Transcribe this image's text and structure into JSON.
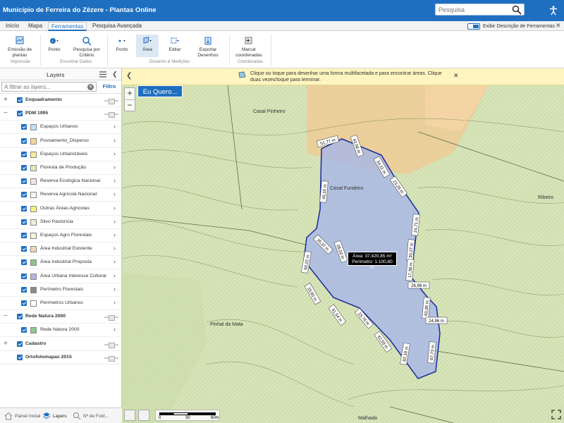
{
  "app": {
    "title": "Município de Ferreira do Zêzere - Plantas Online",
    "search_placeholder": "Pesquisa"
  },
  "tabs": [
    {
      "label": "Início"
    },
    {
      "label": "Mapa"
    },
    {
      "label": "Ferramentas",
      "active": true
    },
    {
      "label": "Pesquisa Avançada"
    }
  ],
  "toggle_description_label": "Exibir Descrição de Ferramentas",
  "ribbon": {
    "buttons": {
      "emissao": "Emissão de plantas",
      "ponto_info": "Ponto",
      "pesquisa_criterio": "Pesquisa por Critério",
      "ponto_draw": "Ponto",
      "area": "Área",
      "editar": "Editar",
      "exportar": "Exportar Desenhos",
      "marcar": "Marcar coordenadas"
    },
    "groups": {
      "impressao": "Impressão",
      "encontrar": "Encontrar Dados",
      "desenho": "Desenho & Medições",
      "coordenadas": "Coordenadas"
    }
  },
  "sidebar": {
    "title": "Layers",
    "filter_placeholder": "A filtrar as layers...",
    "filter_button": "Filtro",
    "layers": [
      {
        "name": "Enquadramento",
        "level": 0,
        "expander": "+",
        "bold": true,
        "swatch": null
      },
      {
        "name": "PDM 1995",
        "level": 0,
        "expander": "−",
        "bold": true,
        "swatch": null
      },
      {
        "name": "Espaços Urbanos",
        "level": 1,
        "swatch": "#bfe3f7"
      },
      {
        "name": "Povoamento_Disperso",
        "level": 1,
        "swatch": "#f2d79a"
      },
      {
        "name": "Espaços Urbanizáveis",
        "level": 1,
        "swatch": "#f7ec9a"
      },
      {
        "name": "Floresta de Produção",
        "level": 1,
        "swatch": "#d9ecb2"
      },
      {
        "name": "Reserva Ecológica Nacional",
        "level": 1,
        "swatch": "#f2e4ea"
      },
      {
        "name": "Reserva Agrícola Nacional",
        "level": 1,
        "swatch": "#f4f4f4"
      },
      {
        "name": "Outras Áreas Agrícolas",
        "level": 1,
        "swatch": "#f7f27a"
      },
      {
        "name": "Silvo Pastorícia",
        "level": 1,
        "swatch": "#eaf0dc"
      },
      {
        "name": "Espaços Agro Florestais",
        "level": 1,
        "swatch": "#f4f2d8"
      },
      {
        "name": "Área Industrial Existente",
        "level": 1,
        "swatch": "#eed7b7"
      },
      {
        "name": "Área Industrial Proposta",
        "level": 1,
        "swatch": "#8ec48a"
      },
      {
        "name": "Área Urbana Interesse Cultural",
        "level": 1,
        "swatch": "#b7b3e3"
      },
      {
        "name": "Perímetro Florestais",
        "level": 1,
        "swatch": "#8a8a8a"
      },
      {
        "name": "Perímetros Urbanos",
        "level": 1,
        "swatch": "#ffffff"
      },
      {
        "name": "Rede Natura 2000",
        "level": 0,
        "expander": "−",
        "bold": true,
        "swatch": null
      },
      {
        "name": "Rede Natura 2000",
        "level": 1,
        "swatch": "#8cc98a"
      },
      {
        "name": "Cadastro",
        "level": 0,
        "expander": "+",
        "bold": true,
        "swatch": null
      },
      {
        "name": "Ortofotomapas 2015",
        "level": 0,
        "expander": "",
        "bold": true,
        "swatch": null
      }
    ],
    "bottom_tabs": [
      {
        "label": "Painel Inicial"
      },
      {
        "label": "Layers",
        "active": true
      },
      {
        "label": "Nº de Fold..."
      }
    ]
  },
  "map": {
    "banner_message": "Clique ou toque para desenhar uma forma multifacetada e para encontrar áreas. Clique duas vezes/toque para terminar.",
    "eu_quero": "Eu Quero...",
    "area_label": "Área: 37.420,85 m²",
    "perimeter_label": "Perímetro: 1.100,80 m",
    "segments": [
      "51,77 m",
      "42,56 m",
      "34,11 m",
      "23,26 m",
      "24,71 m",
      "30,27 m",
      "17,38 m",
      "26,98 m",
      "60,90 m",
      "24,96 m",
      "97,73 m",
      "82,19 m",
      "42,59 m",
      "23,76 m",
      "41,54 m",
      "33,60 m",
      "60,02 m",
      "35,37 m",
      "28,03 m",
      "46,15 m"
    ],
    "place_names": [
      "Casal Pinheiro",
      "Casal Fundeiro",
      "Ribeiro",
      "Pinhal da Mata",
      "Malhada"
    ],
    "scale_labels": [
      "0",
      "30",
      "60m"
    ]
  },
  "colors": {
    "brand": "#1f6fc0",
    "polygon_fill": "#a8b6e8",
    "polygon_stroke": "#1a2a9c",
    "banner_bg": "#fff5c0"
  }
}
